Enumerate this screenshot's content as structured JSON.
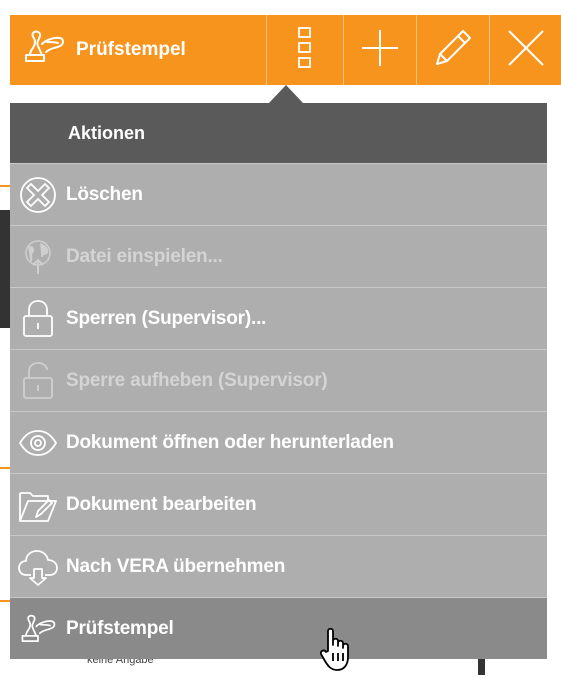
{
  "top_cut_text": "...",
  "toolbar": {
    "stamp_label": "Prüfstempel",
    "icons": [
      "stamp-icon",
      "menu-squares-icon",
      "plus-icon",
      "pencil-icon",
      "close-icon"
    ]
  },
  "menu": {
    "header": "Aktionen",
    "items": [
      {
        "label": "Löschen",
        "icon": "delete-circle-icon",
        "disabled": false
      },
      {
        "label": "Datei einspielen...",
        "icon": "globe-upload-icon",
        "disabled": true
      },
      {
        "label": "Sperren (Supervisor)...",
        "icon": "lock-icon",
        "disabled": false
      },
      {
        "label": "Sperre aufheben (Supervisor)",
        "icon": "unlock-icon",
        "disabled": true
      },
      {
        "label": "Dokument öffnen oder herunterladen",
        "icon": "eye-icon",
        "disabled": false
      },
      {
        "label": "Dokument bearbeiten",
        "icon": "folder-edit-icon",
        "disabled": false
      },
      {
        "label": "Nach VERA übernehmen",
        "icon": "cloud-download-icon",
        "disabled": false
      },
      {
        "label": "Prüfstempel",
        "icon": "stamp-icon",
        "disabled": false,
        "hover": true
      }
    ]
  },
  "background": {
    "footer_text": "keine Angabe"
  },
  "colors": {
    "toolbar": "#f7941d",
    "menu_header": "#5a5a5a",
    "menu_body": "#aeaeae",
    "menu_hover": "#8a8a8a"
  }
}
